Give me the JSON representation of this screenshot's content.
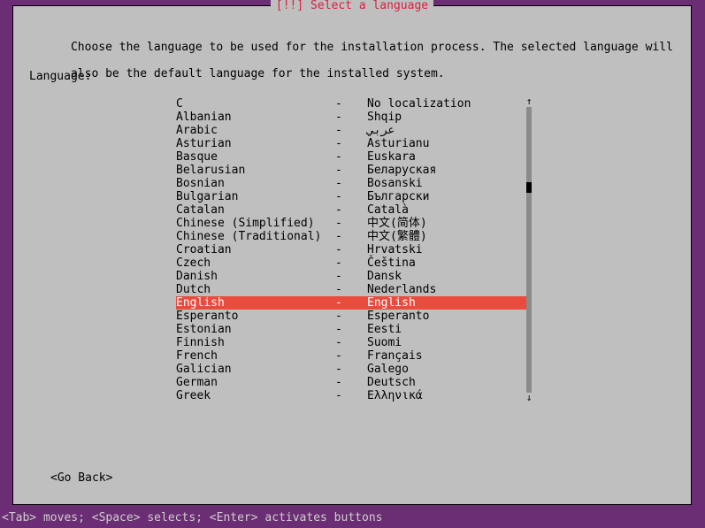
{
  "title": "[!!] Select a language",
  "instructions_line1": "Choose the language to be used for the installation process. The selected language will",
  "instructions_line2": "also be the default language for the installed system.",
  "prompt": "Language:",
  "go_back": "<Go Back>",
  "hint": "<Tab> moves; <Space> selects; <Enter> activates buttons",
  "sep": "-",
  "selected_index": 15,
  "languages": [
    {
      "name": "C",
      "localized": "No localization"
    },
    {
      "name": "Albanian",
      "localized": "Shqip"
    },
    {
      "name": "Arabic",
      "localized": "عربي"
    },
    {
      "name": "Asturian",
      "localized": "Asturianu"
    },
    {
      "name": "Basque",
      "localized": "Euskara"
    },
    {
      "name": "Belarusian",
      "localized": "Беларуская"
    },
    {
      "name": "Bosnian",
      "localized": "Bosanski"
    },
    {
      "name": "Bulgarian",
      "localized": "Български"
    },
    {
      "name": "Catalan",
      "localized": "Català"
    },
    {
      "name": "Chinese (Simplified)",
      "localized": "中文(简体)"
    },
    {
      "name": "Chinese (Traditional)",
      "localized": "中文(繁體)"
    },
    {
      "name": "Croatian",
      "localized": "Hrvatski"
    },
    {
      "name": "Czech",
      "localized": "Čeština"
    },
    {
      "name": "Danish",
      "localized": "Dansk"
    },
    {
      "name": "Dutch",
      "localized": "Nederlands"
    },
    {
      "name": "English",
      "localized": "English"
    },
    {
      "name": "Esperanto",
      "localized": "Esperanto"
    },
    {
      "name": "Estonian",
      "localized": "Eesti"
    },
    {
      "name": "Finnish",
      "localized": "Suomi"
    },
    {
      "name": "French",
      "localized": "Français"
    },
    {
      "name": "Galician",
      "localized": "Galego"
    },
    {
      "name": "German",
      "localized": "Deutsch"
    },
    {
      "name": "Greek",
      "localized": "Ελληνικά"
    }
  ]
}
